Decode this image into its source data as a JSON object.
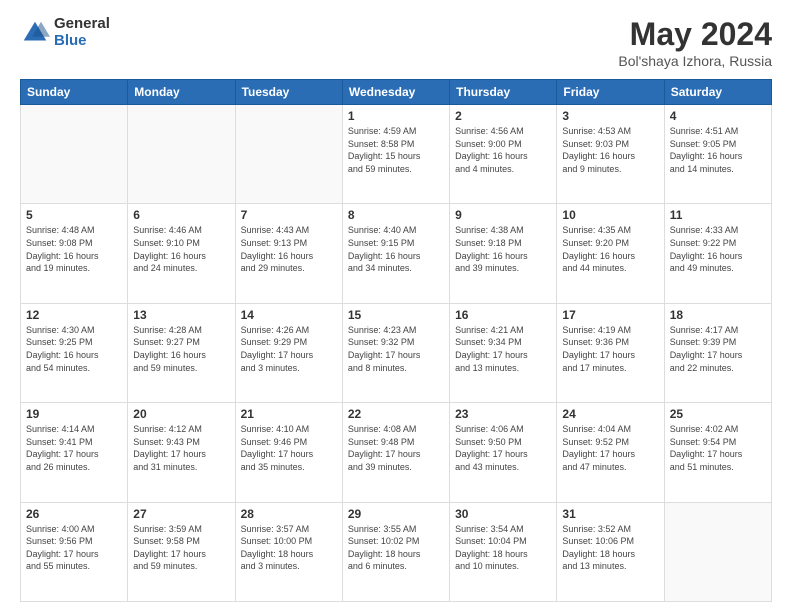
{
  "header": {
    "logo_general": "General",
    "logo_blue": "Blue",
    "title": "May 2024",
    "subtitle": "Bol'shaya Izhora, Russia"
  },
  "weekdays": [
    "Sunday",
    "Monday",
    "Tuesday",
    "Wednesday",
    "Thursday",
    "Friday",
    "Saturday"
  ],
  "weeks": [
    [
      {
        "day": "",
        "info": ""
      },
      {
        "day": "",
        "info": ""
      },
      {
        "day": "",
        "info": ""
      },
      {
        "day": "1",
        "info": "Sunrise: 4:59 AM\nSunset: 8:58 PM\nDaylight: 15 hours\nand 59 minutes."
      },
      {
        "day": "2",
        "info": "Sunrise: 4:56 AM\nSunset: 9:00 PM\nDaylight: 16 hours\nand 4 minutes."
      },
      {
        "day": "3",
        "info": "Sunrise: 4:53 AM\nSunset: 9:03 PM\nDaylight: 16 hours\nand 9 minutes."
      },
      {
        "day": "4",
        "info": "Sunrise: 4:51 AM\nSunset: 9:05 PM\nDaylight: 16 hours\nand 14 minutes."
      }
    ],
    [
      {
        "day": "5",
        "info": "Sunrise: 4:48 AM\nSunset: 9:08 PM\nDaylight: 16 hours\nand 19 minutes."
      },
      {
        "day": "6",
        "info": "Sunrise: 4:46 AM\nSunset: 9:10 PM\nDaylight: 16 hours\nand 24 minutes."
      },
      {
        "day": "7",
        "info": "Sunrise: 4:43 AM\nSunset: 9:13 PM\nDaylight: 16 hours\nand 29 minutes."
      },
      {
        "day": "8",
        "info": "Sunrise: 4:40 AM\nSunset: 9:15 PM\nDaylight: 16 hours\nand 34 minutes."
      },
      {
        "day": "9",
        "info": "Sunrise: 4:38 AM\nSunset: 9:18 PM\nDaylight: 16 hours\nand 39 minutes."
      },
      {
        "day": "10",
        "info": "Sunrise: 4:35 AM\nSunset: 9:20 PM\nDaylight: 16 hours\nand 44 minutes."
      },
      {
        "day": "11",
        "info": "Sunrise: 4:33 AM\nSunset: 9:22 PM\nDaylight: 16 hours\nand 49 minutes."
      }
    ],
    [
      {
        "day": "12",
        "info": "Sunrise: 4:30 AM\nSunset: 9:25 PM\nDaylight: 16 hours\nand 54 minutes."
      },
      {
        "day": "13",
        "info": "Sunrise: 4:28 AM\nSunset: 9:27 PM\nDaylight: 16 hours\nand 59 minutes."
      },
      {
        "day": "14",
        "info": "Sunrise: 4:26 AM\nSunset: 9:29 PM\nDaylight: 17 hours\nand 3 minutes."
      },
      {
        "day": "15",
        "info": "Sunrise: 4:23 AM\nSunset: 9:32 PM\nDaylight: 17 hours\nand 8 minutes."
      },
      {
        "day": "16",
        "info": "Sunrise: 4:21 AM\nSunset: 9:34 PM\nDaylight: 17 hours\nand 13 minutes."
      },
      {
        "day": "17",
        "info": "Sunrise: 4:19 AM\nSunset: 9:36 PM\nDaylight: 17 hours\nand 17 minutes."
      },
      {
        "day": "18",
        "info": "Sunrise: 4:17 AM\nSunset: 9:39 PM\nDaylight: 17 hours\nand 22 minutes."
      }
    ],
    [
      {
        "day": "19",
        "info": "Sunrise: 4:14 AM\nSunset: 9:41 PM\nDaylight: 17 hours\nand 26 minutes."
      },
      {
        "day": "20",
        "info": "Sunrise: 4:12 AM\nSunset: 9:43 PM\nDaylight: 17 hours\nand 31 minutes."
      },
      {
        "day": "21",
        "info": "Sunrise: 4:10 AM\nSunset: 9:46 PM\nDaylight: 17 hours\nand 35 minutes."
      },
      {
        "day": "22",
        "info": "Sunrise: 4:08 AM\nSunset: 9:48 PM\nDaylight: 17 hours\nand 39 minutes."
      },
      {
        "day": "23",
        "info": "Sunrise: 4:06 AM\nSunset: 9:50 PM\nDaylight: 17 hours\nand 43 minutes."
      },
      {
        "day": "24",
        "info": "Sunrise: 4:04 AM\nSunset: 9:52 PM\nDaylight: 17 hours\nand 47 minutes."
      },
      {
        "day": "25",
        "info": "Sunrise: 4:02 AM\nSunset: 9:54 PM\nDaylight: 17 hours\nand 51 minutes."
      }
    ],
    [
      {
        "day": "26",
        "info": "Sunrise: 4:00 AM\nSunset: 9:56 PM\nDaylight: 17 hours\nand 55 minutes."
      },
      {
        "day": "27",
        "info": "Sunrise: 3:59 AM\nSunset: 9:58 PM\nDaylight: 17 hours\nand 59 minutes."
      },
      {
        "day": "28",
        "info": "Sunrise: 3:57 AM\nSunset: 10:00 PM\nDaylight: 18 hours\nand 3 minutes."
      },
      {
        "day": "29",
        "info": "Sunrise: 3:55 AM\nSunset: 10:02 PM\nDaylight: 18 hours\nand 6 minutes."
      },
      {
        "day": "30",
        "info": "Sunrise: 3:54 AM\nSunset: 10:04 PM\nDaylight: 18 hours\nand 10 minutes."
      },
      {
        "day": "31",
        "info": "Sunrise: 3:52 AM\nSunset: 10:06 PM\nDaylight: 18 hours\nand 13 minutes."
      },
      {
        "day": "",
        "info": ""
      }
    ]
  ]
}
